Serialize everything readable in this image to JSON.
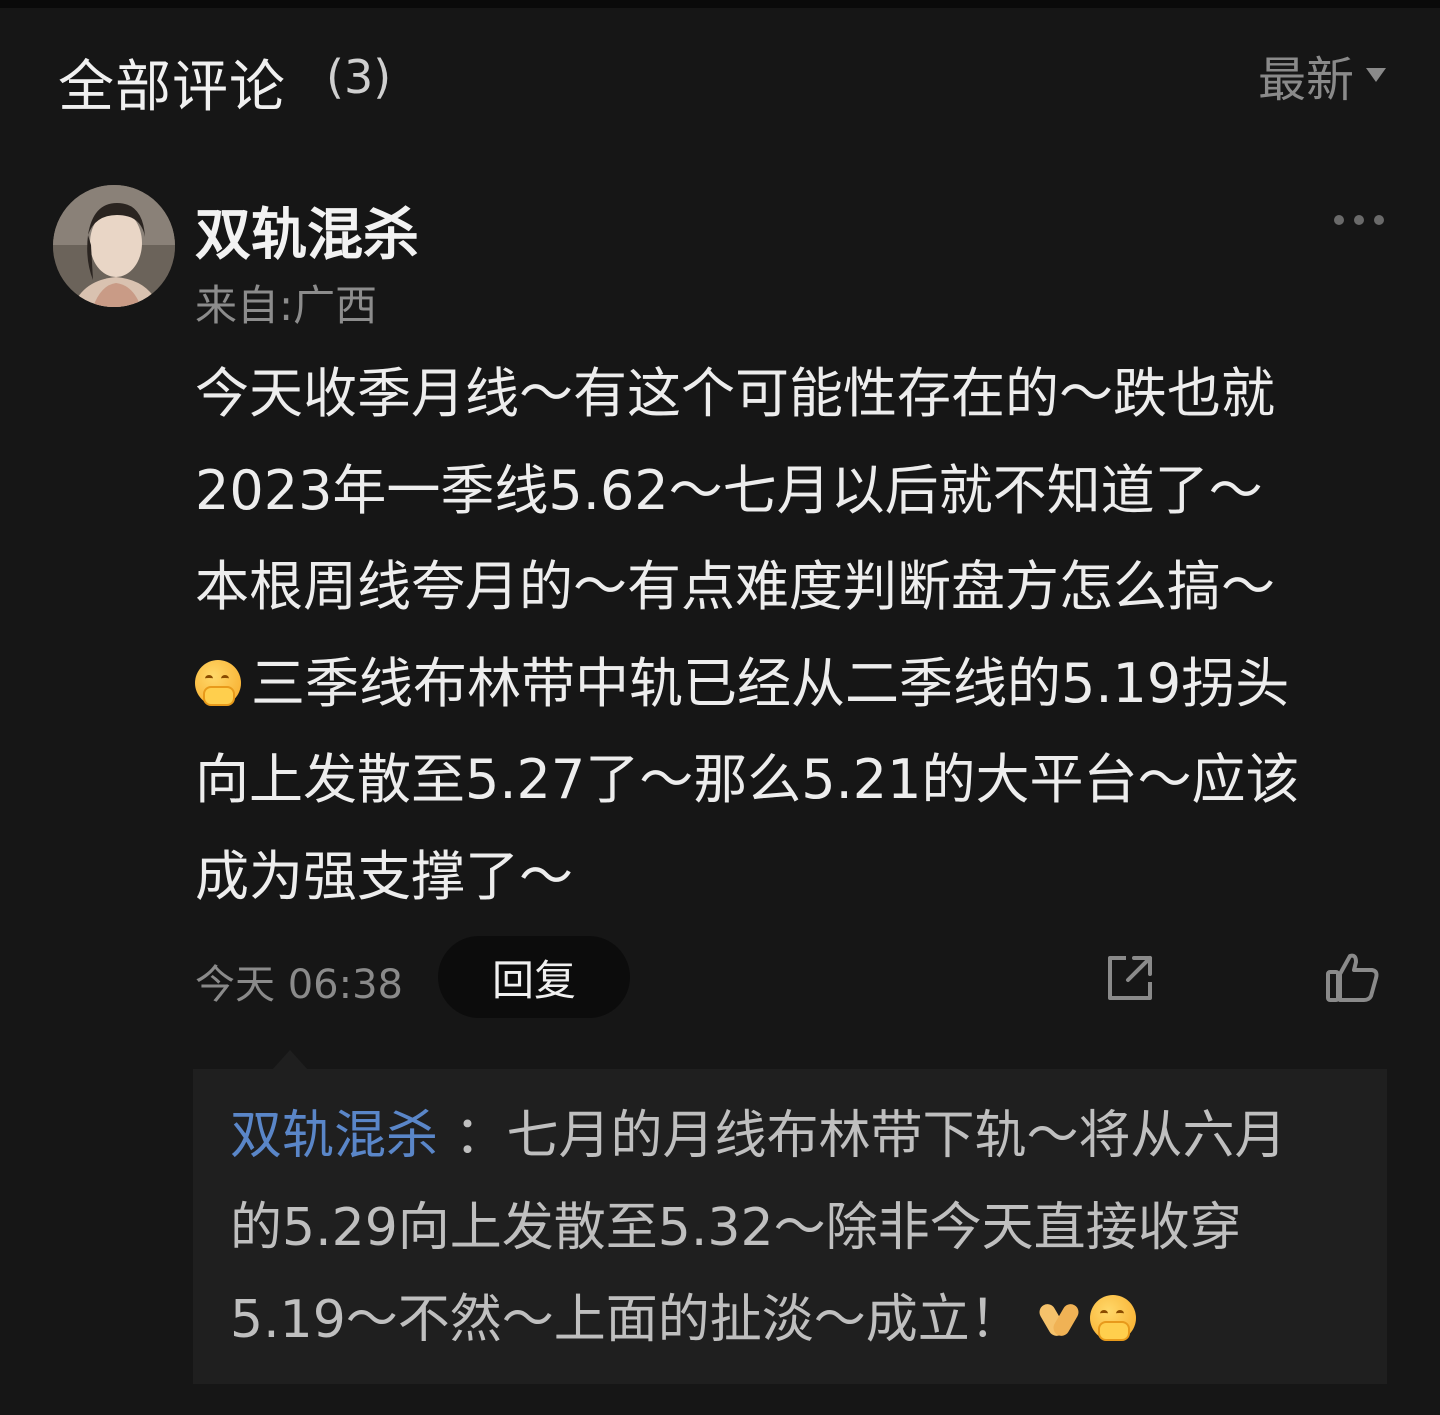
{
  "header": {
    "title": "全部评论",
    "count": "(3)",
    "sort_label": "最新"
  },
  "comment": {
    "author": "双轨混杀",
    "location": "来自:广西",
    "lines": [
      "今天收季月线～有这个可能性存在的～跌也就",
      "2023年一季线5.62～七月以后就不知道了～",
      "本根周线夸月的～有点难度判断盘方怎么搞～",
      "三季线布林带中轨已经从二季线的5.19拐头",
      "向上发散至5.27了～那么5.21的大平台～应该",
      "成为强支撑了～"
    ],
    "time": "今天 06:38",
    "reply_label": "回复",
    "icons": {
      "more": "more-dots-icon",
      "share": "share-icon",
      "like": "thumbs-up-icon",
      "emoji": "blush-smile-emoji"
    }
  },
  "sub_reply": {
    "author": "双轨混杀",
    "separator": " ：",
    "line1_text": "七月的月线布林带下轨～将从六月",
    "line2": "的5.29向上发散至5.32～除非今天直接收穿",
    "line3": "5.19～不然～上面的扯淡～成立！",
    "author_color": "#5a86c8",
    "icons": [
      "clap-emoji",
      "blush-smile-emoji"
    ]
  }
}
